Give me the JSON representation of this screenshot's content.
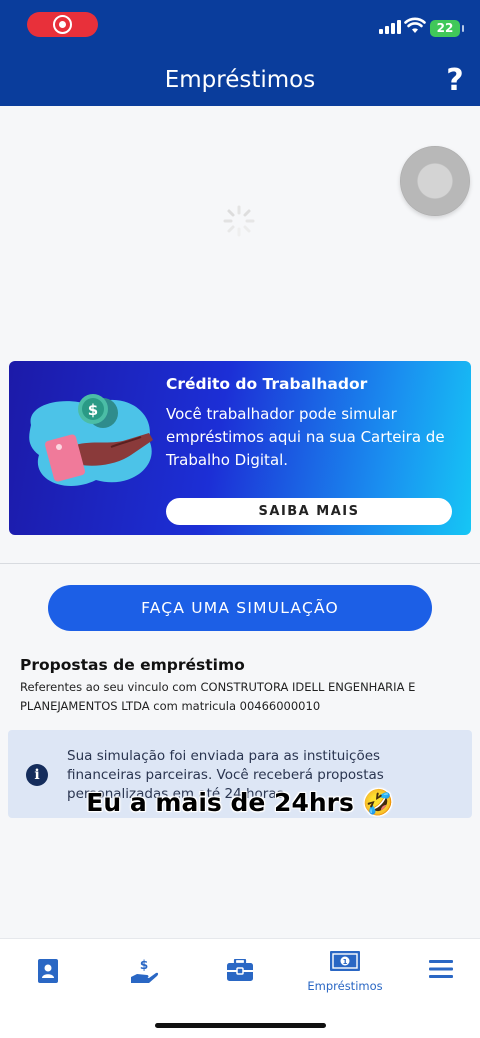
{
  "status_bar": {
    "battery": "22"
  },
  "header": {
    "title": "Empréstimos",
    "help_label": "?"
  },
  "promo": {
    "title": "Crédito do Trabalhador",
    "description": "Você trabalhador pode simular empréstimos aqui na sua Carteira de Trabalho Digital.",
    "button_label": "SAIBA MAIS"
  },
  "simulation": {
    "button_label": "FAÇA UMA SIMULAÇÃO"
  },
  "proposals": {
    "title": "Propostas de empréstimo",
    "description": "Referentes ao seu vinculo com CONSTRUTORA IDELL ENGENHARIA E PLANEJAMENTOS LTDA com matricula 00466000010"
  },
  "info_box": {
    "text": "Sua simulação foi enviada para as instituições financeiras parceiras. Você receberá propostas personalizadas em até 24 horas."
  },
  "overlay_caption": "Eu a mais de 24hrs 🤣",
  "bottom_nav": {
    "items": [
      {
        "icon": "id-card-icon",
        "label": ""
      },
      {
        "icon": "hand-money-icon",
        "label": ""
      },
      {
        "icon": "briefcase-icon",
        "label": ""
      },
      {
        "icon": "banknote-icon",
        "label": "Empréstimos",
        "active": true
      },
      {
        "icon": "menu-icon",
        "label": ""
      }
    ]
  },
  "colors": {
    "header": "#0a3d9c",
    "primary_button": "#1c5fe6",
    "nav_active": "#2a67c4",
    "info_bg": "#dde6f5"
  }
}
